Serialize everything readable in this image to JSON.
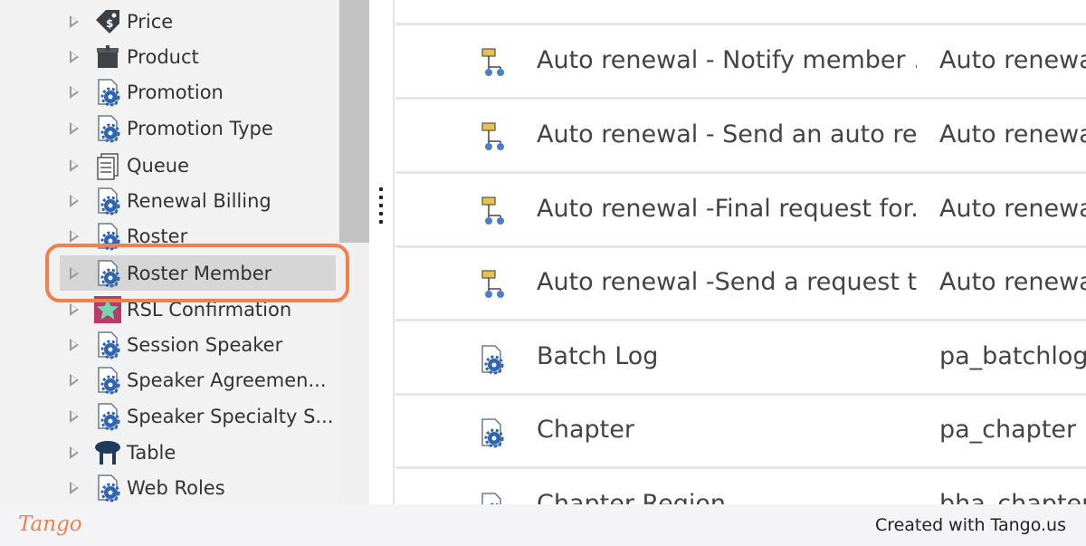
{
  "tree": {
    "items": [
      {
        "label": "Price",
        "icon": "price-tag-icon"
      },
      {
        "label": "Product",
        "icon": "product-box-icon"
      },
      {
        "label": "Promotion",
        "icon": "entity-gear-icon"
      },
      {
        "label": "Promotion Type",
        "icon": "entity-gear-icon"
      },
      {
        "label": "Queue",
        "icon": "queue-icon"
      },
      {
        "label": "Renewal Billing",
        "icon": "entity-gear-icon"
      },
      {
        "label": "Roster",
        "icon": "entity-gear-icon"
      },
      {
        "label": "Roster Member",
        "icon": "entity-gear-icon",
        "selected": true
      },
      {
        "label": "RSL Confirmation",
        "icon": "star-icon"
      },
      {
        "label": "Session Speaker",
        "icon": "entity-gear-icon"
      },
      {
        "label": "Speaker Agreemen...",
        "icon": "entity-gear-icon"
      },
      {
        "label": "Speaker Specialty S...",
        "icon": "entity-gear-icon"
      },
      {
        "label": "Table",
        "icon": "table-icon"
      },
      {
        "label": "Web Roles",
        "icon": "entity-gear-icon"
      }
    ]
  },
  "grid": {
    "rows": [
      {
        "name": "Auto renewal - Notify member ...",
        "schema": "Auto renewa",
        "icon": "process-icon"
      },
      {
        "name": "Auto renewal - Send an auto re...",
        "schema": "Auto renewa",
        "icon": "process-icon"
      },
      {
        "name": "Auto renewal -Final request for...",
        "schema": "Auto renewa",
        "icon": "process-icon"
      },
      {
        "name": "Auto renewal -Send a request t...",
        "schema": "Auto renewa",
        "icon": "process-icon"
      },
      {
        "name": "Batch Log",
        "schema": "pa_batchlog",
        "icon": "entity-gear-icon"
      },
      {
        "name": "Chapter",
        "schema": "pa_chapter",
        "icon": "entity-gear-icon"
      },
      {
        "name": "Chapter Region",
        "schema": "bha_chapter",
        "icon": "entity-gear-icon"
      }
    ]
  },
  "footer": {
    "logo": "Tango",
    "credit": "Created with Tango.us"
  },
  "colors": {
    "highlight": "#f0804d",
    "selected_row": "#d6d6d6"
  }
}
